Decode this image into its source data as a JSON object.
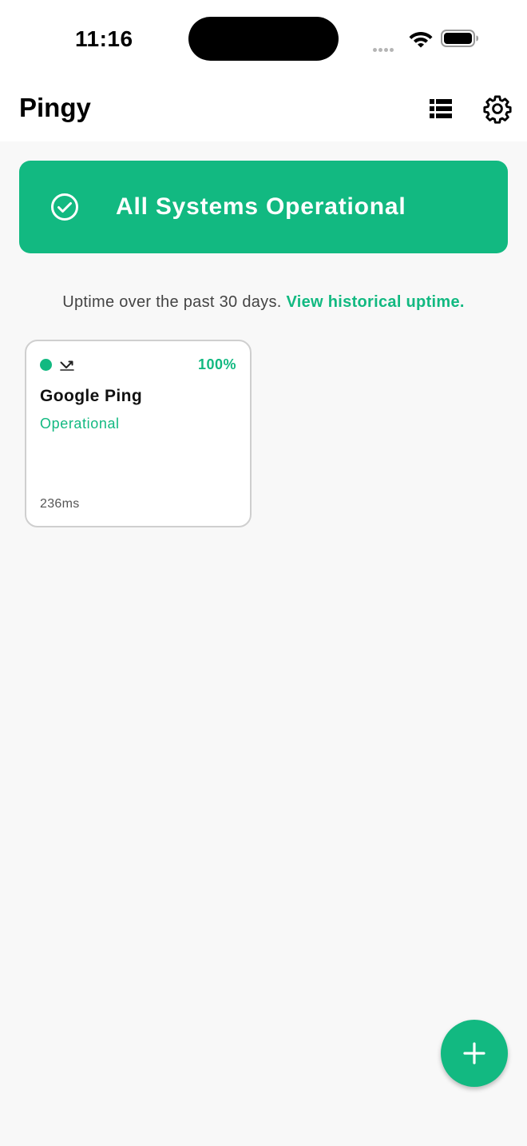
{
  "status_bar": {
    "time": "11:16",
    "signal_icon": "cellular-signal-icon",
    "wifi_icon": "wifi-icon",
    "battery_icon": "battery-icon"
  },
  "app_bar": {
    "title": "Pingy",
    "list_icon": "list-view-icon",
    "settings_icon": "gear-icon"
  },
  "banner": {
    "icon": "check-circle-icon",
    "text": "All Systems Operational",
    "color": "#12b981"
  },
  "uptime_caption": {
    "text": "Uptime over the past 30 days.",
    "link": "View historical uptime."
  },
  "monitors": [
    {
      "name": "Google Ping",
      "status": "Operational",
      "uptime": "100%",
      "latency": "236ms",
      "type_icon": "ping-icon",
      "status_color": "#12b981"
    }
  ],
  "fab": {
    "icon": "plus-icon"
  },
  "colors": {
    "accent": "#12b981",
    "background": "#f8f8f8",
    "surface": "#ffffff"
  }
}
